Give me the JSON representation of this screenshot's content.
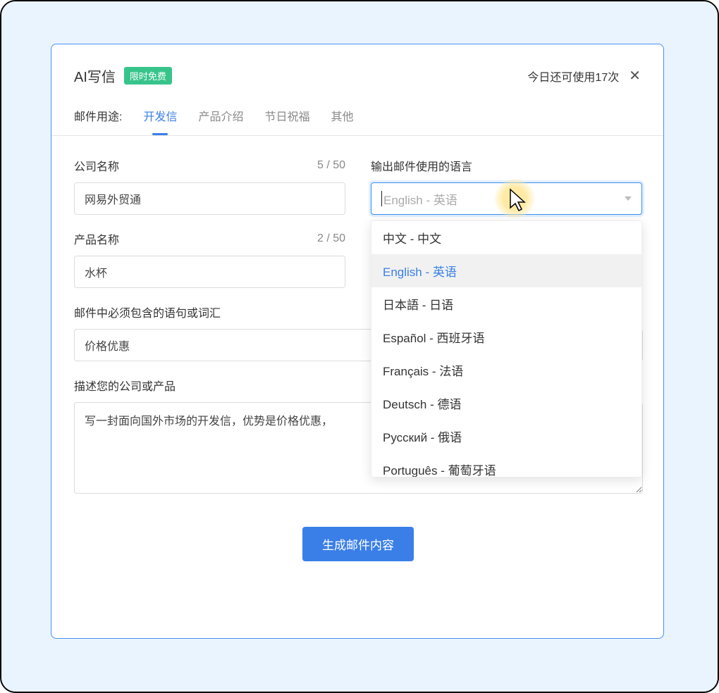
{
  "header": {
    "title": "AI写信",
    "badge": "限时免费",
    "usage_text": "今日还可使用17次"
  },
  "tabs": {
    "label": "邮件用途:",
    "items": [
      {
        "label": "开发信",
        "active": true
      },
      {
        "label": "产品介绍",
        "active": false
      },
      {
        "label": "节日祝福",
        "active": false
      },
      {
        "label": "其他",
        "active": false
      }
    ]
  },
  "fields": {
    "company": {
      "label": "公司名称",
      "value": "网易外贸通",
      "count": "5 / 50"
    },
    "language": {
      "label": "输出邮件使用的语言",
      "placeholder": "English - 英语",
      "options": [
        "中文 - 中文",
        "English - 英语",
        "日本語 - 日语",
        "Español - 西班牙语",
        "Français - 法语",
        "Deutsch - 德语",
        "Русский - 俄语",
        "Português - 葡萄牙语"
      ],
      "selected_index": 1
    },
    "product": {
      "label": "产品名称",
      "value": "水杯",
      "count": "2 / 50"
    },
    "keywords": {
      "label": "邮件中必须包含的语句或词汇",
      "value": "价格优惠"
    },
    "description": {
      "label": "描述您的公司或产品",
      "value": "写一封面向国外市场的开发信，优势是价格优惠，"
    }
  },
  "submit_label": "生成邮件内容"
}
